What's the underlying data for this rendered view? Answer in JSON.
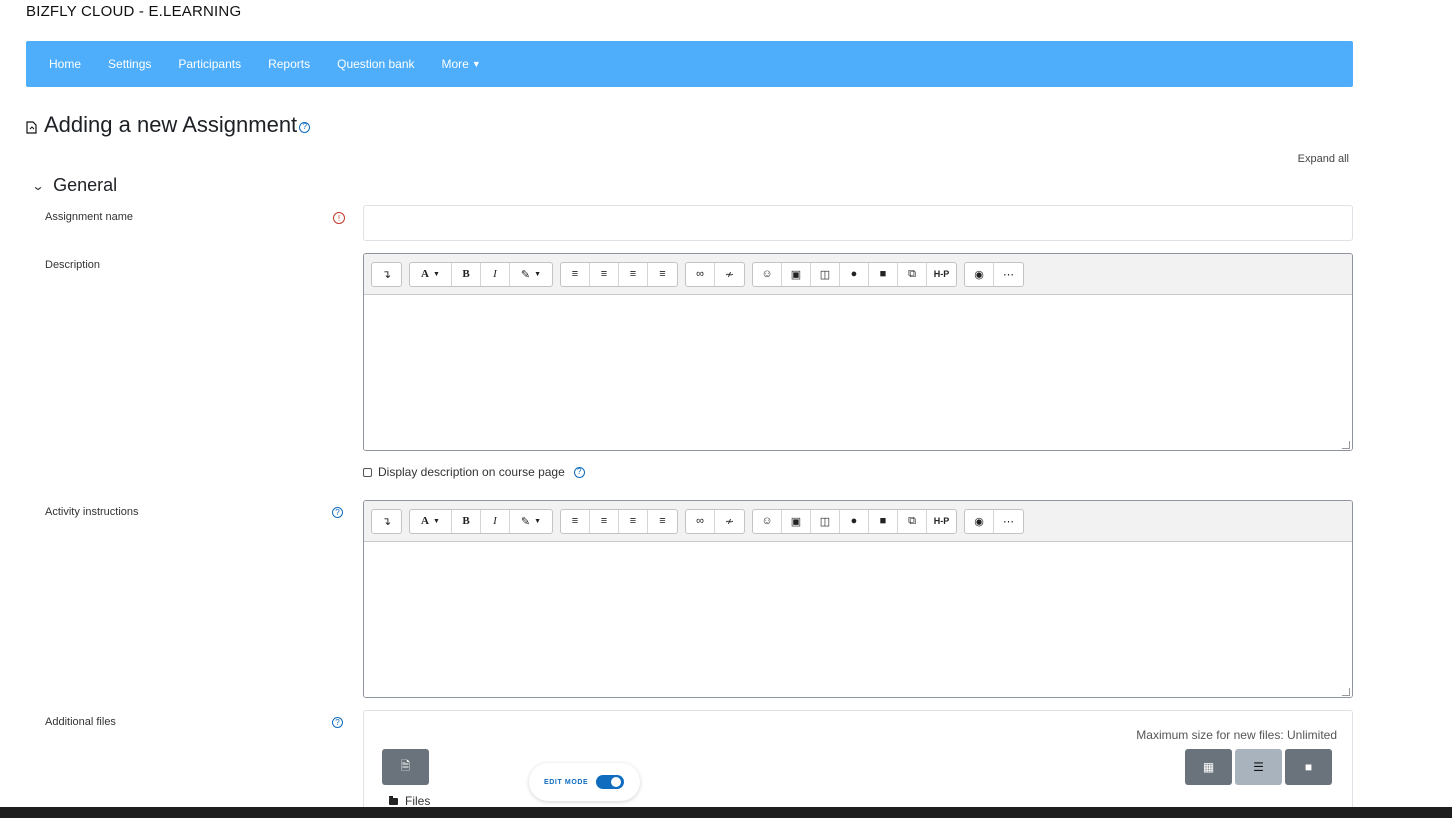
{
  "site": {
    "title": "BIZFLY CLOUD - E.LEARNING"
  },
  "nav": {
    "items": [
      {
        "label": "Home"
      },
      {
        "label": "Settings"
      },
      {
        "label": "Participants"
      },
      {
        "label": "Reports"
      },
      {
        "label": "Question bank"
      },
      {
        "label": "More"
      }
    ]
  },
  "page": {
    "title": "Adding a new Assignment",
    "expand_all": "Expand all"
  },
  "section": {
    "title": "General"
  },
  "form": {
    "assignment_name": {
      "label": "Assignment name",
      "value": ""
    },
    "description": {
      "label": "Description"
    },
    "display_description": {
      "label": "Display description on course page",
      "checked": false
    },
    "activity_instructions": {
      "label": "Activity instructions"
    },
    "additional_files": {
      "label": "Additional files",
      "max_size": "Maximum size for new files: Unlimited",
      "files_label": "Files"
    }
  },
  "editor_toolbar": {
    "groups": [
      [
        "collapse-icon"
      ],
      [
        "font-style-icon",
        "bold-icon",
        "italic-icon",
        "text-color-icon"
      ],
      [
        "unordered-list-icon",
        "ordered-list-icon",
        "outdent-icon",
        "indent-icon"
      ],
      [
        "link-icon",
        "unlink-icon"
      ],
      [
        "emoji-icon",
        "image-icon",
        "media-icon",
        "record-audio-icon",
        "record-video-icon",
        "manage-files-icon",
        "h5p-icon"
      ],
      [
        "accessibility-checker-icon",
        "screenreader-helper-icon"
      ]
    ],
    "h5p_text": "H-P"
  },
  "edit_mode": {
    "label": "EDIT MODE",
    "enabled": true
  },
  "colors": {
    "navbar": "#4eaefb",
    "primary": "#0f6cbf",
    "required": "#c0392b"
  }
}
